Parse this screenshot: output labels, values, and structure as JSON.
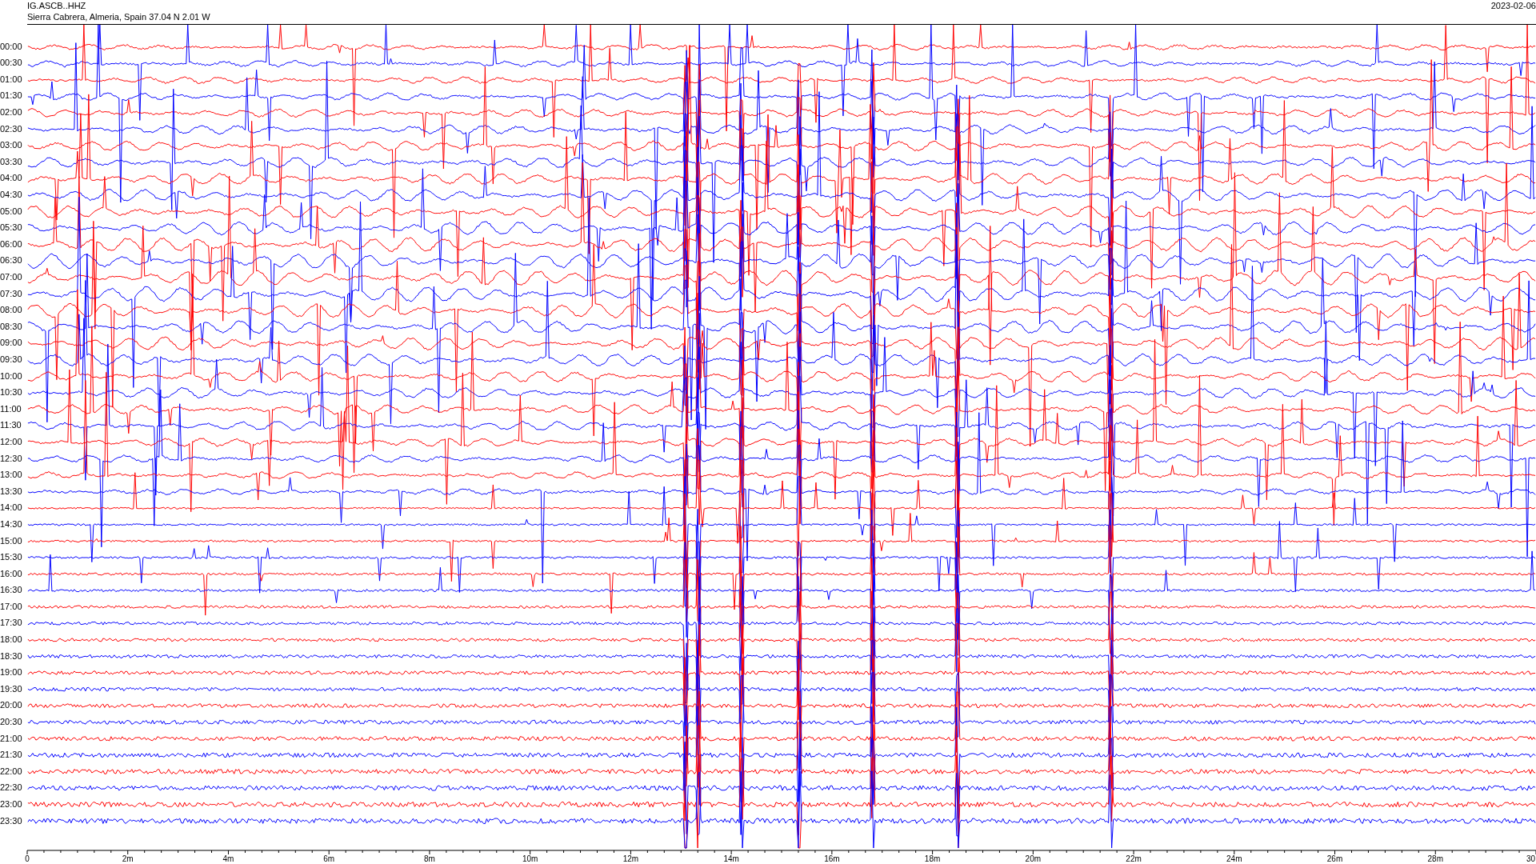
{
  "header": {
    "channel": "IG.ASCB..HHZ",
    "location": "Sierra Cabrera, Almeria, Spain  37.04 N 2.01 W",
    "date": "2023-02-06"
  },
  "rows": [
    {
      "label": "00:00"
    },
    {
      "label": "00:30"
    },
    {
      "label": "01:00"
    },
    {
      "label": "01:30"
    },
    {
      "label": "02:00"
    },
    {
      "label": "02:30"
    },
    {
      "label": "03:00"
    },
    {
      "label": "03:30"
    },
    {
      "label": "04:00"
    },
    {
      "label": "04:30"
    },
    {
      "label": "05:00"
    },
    {
      "label": "05:30"
    },
    {
      "label": "06:00"
    },
    {
      "label": "06:30"
    },
    {
      "label": "07:00"
    },
    {
      "label": "07:30"
    },
    {
      "label": "08:00"
    },
    {
      "label": "08:30"
    },
    {
      "label": "09:00"
    },
    {
      "label": "09:30"
    },
    {
      "label": "10:00"
    },
    {
      "label": "10:30"
    },
    {
      "label": "11:00"
    },
    {
      "label": "11:30"
    },
    {
      "label": "12:00"
    },
    {
      "label": "12:30"
    },
    {
      "label": "13:00"
    },
    {
      "label": "13:30"
    },
    {
      "label": "14:00"
    },
    {
      "label": "14:30"
    },
    {
      "label": "15:00"
    },
    {
      "label": "15:30"
    },
    {
      "label": "16:00"
    },
    {
      "label": "16:30"
    },
    {
      "label": "17:00"
    },
    {
      "label": "17:30"
    },
    {
      "label": "18:00"
    },
    {
      "label": "18:30"
    },
    {
      "label": "19:00"
    },
    {
      "label": "19:30"
    },
    {
      "label": "20:00"
    },
    {
      "label": "20:30"
    },
    {
      "label": "21:00"
    },
    {
      "label": "21:30"
    },
    {
      "label": "22:00"
    },
    {
      "label": "22:30"
    },
    {
      "label": "23:00"
    },
    {
      "label": "23:30"
    }
  ],
  "x_axis": {
    "ticks": [
      "0",
      "2m",
      "4m",
      "6m",
      "8m",
      "10m",
      "12m",
      "14m",
      "16m",
      "18m",
      "20m",
      "22m",
      "24m",
      "26m",
      "28m",
      "30"
    ]
  }
}
